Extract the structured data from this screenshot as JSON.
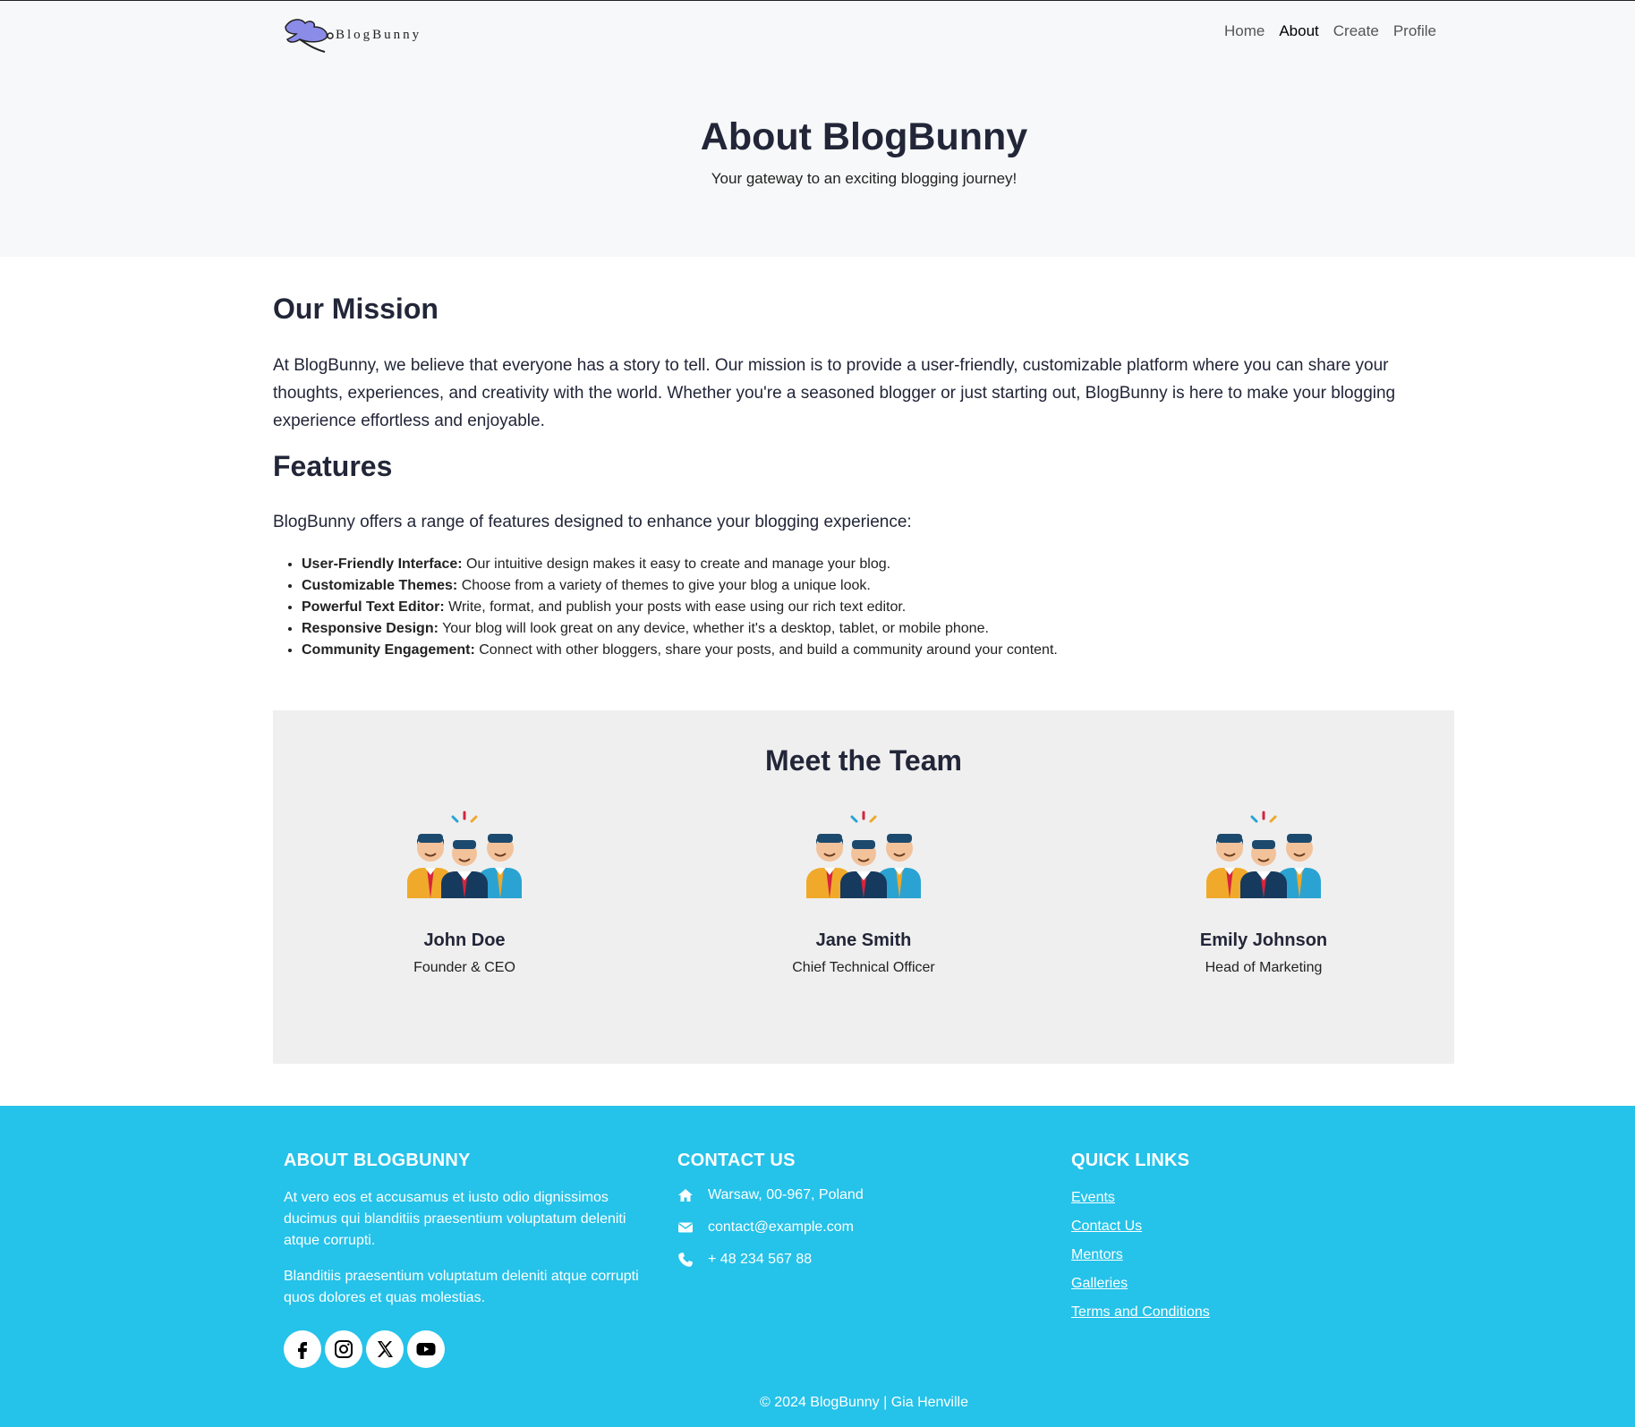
{
  "brand": {
    "name": "BlogBunny"
  },
  "nav": {
    "items": [
      {
        "label": "Home"
      },
      {
        "label": "About"
      },
      {
        "label": "Create"
      },
      {
        "label": "Profile"
      }
    ]
  },
  "hero": {
    "title": "About BlogBunny",
    "subtitle": "Your gateway to an exciting blogging journey!"
  },
  "mission": {
    "title": "Our Mission",
    "text": "At BlogBunny, we believe that everyone has a story to tell. Our mission is to provide a user-friendly, customizable platform where you can share your thoughts, experiences, and creativity with the world. Whether you're a seasoned blogger or just starting out, BlogBunny is here to make your blogging experience effortless and enjoyable."
  },
  "features": {
    "title": "Features",
    "intro": "BlogBunny offers a range of features designed to enhance your blogging experience:",
    "items": [
      {
        "name": "User-Friendly Interface:",
        "desc": " Our intuitive design makes it easy to create and manage your blog."
      },
      {
        "name": "Customizable Themes:",
        "desc": " Choose from a variety of themes to give your blog a unique look."
      },
      {
        "name": "Powerful Text Editor:",
        "desc": " Write, format, and publish your posts with ease using our rich text editor."
      },
      {
        "name": "Responsive Design:",
        "desc": " Your blog will look great on any device, whether it's a desktop, tablet, or mobile phone."
      },
      {
        "name": "Community Engagement:",
        "desc": " Connect with other bloggers, share your posts, and build a community around your content."
      }
    ]
  },
  "team": {
    "title": "Meet the Team",
    "members": [
      {
        "name": "John Doe",
        "role": "Founder & CEO",
        "icon": "team-group-icon"
      },
      {
        "name": "Jane Smith",
        "role": "Chief Technical Officer",
        "icon": "team-group-icon"
      },
      {
        "name": "Emily Johnson",
        "role": "Head of Marketing",
        "icon": "team-group-icon"
      }
    ]
  },
  "footer": {
    "about": {
      "title": "ABOUT BLOGBUNNY",
      "p1": "At vero eos et accusamus et iusto odio dignissimos ducimus qui blanditiis praesentium voluptatum deleniti atque corrupti.",
      "p2": "Blanditiis praesentium voluptatum deleniti atque corrupti quos dolores et quas molestias."
    },
    "socials": [
      "facebook-icon",
      "instagram-icon",
      "x-icon",
      "youtube-icon"
    ],
    "contact": {
      "title": "CONTACT US",
      "address": "Warsaw, 00-967, Poland",
      "email": "contact@example.com",
      "phone": "+ 48 234 567 88"
    },
    "links": {
      "title": "QUICK LINKS",
      "items": [
        "Events",
        "Contact Us",
        "Mentors",
        "Galleries",
        "Terms and Conditions"
      ]
    },
    "copyright": "© 2024 BlogBunny | Gia Henville"
  },
  "colors": {
    "footer_bg": "#25c2e9",
    "team_bg": "#efefef",
    "hero_bg": "#f7f8f9",
    "heading": "#222638"
  }
}
